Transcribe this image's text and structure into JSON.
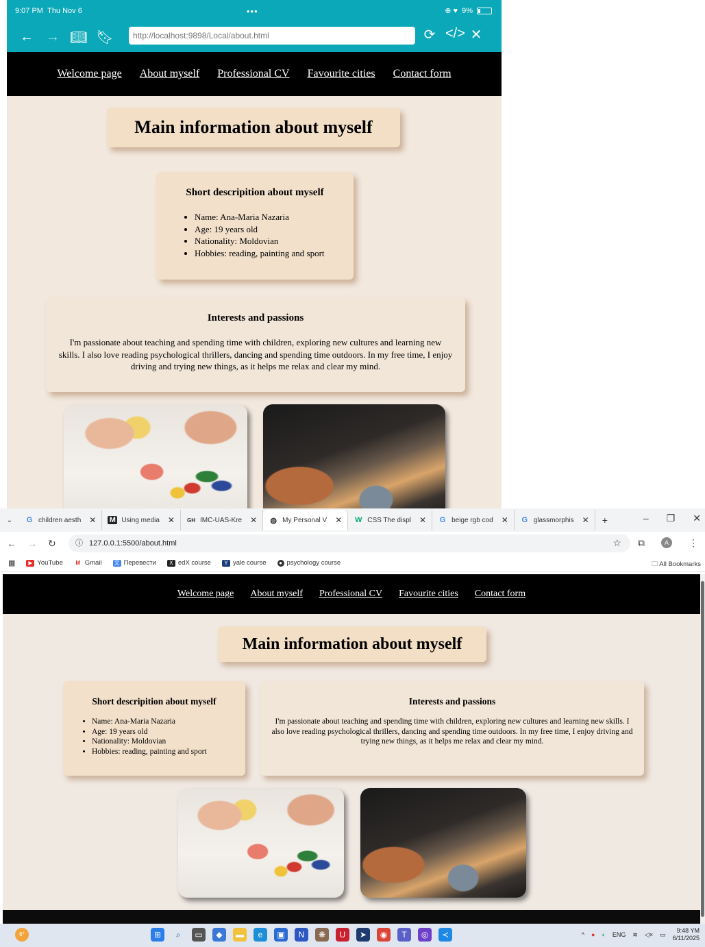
{
  "site": {
    "nav": [
      "Welcome page",
      "About myself",
      "Professional CV",
      "Favourite cities",
      "Contact form"
    ],
    "title": "Main information about myself",
    "short": {
      "heading": "Short descripition about myself",
      "items": [
        "Name: Ana-Maria Nazaria",
        "Age: 19 years old",
        "Nationality: Moldovian",
        "Hobbies: reading, painting and sport"
      ]
    },
    "interests": {
      "heading": "Interests and passions",
      "text": "I'm passionate about teaching and spending time with children, exploring new cultures and learning new skills. I also love reading psychological thrillers, dancing and spending time outdoors. In my free time, I enjoy driving and trying new things, as it helps me relax and clear my mind."
    }
  },
  "ipad": {
    "time": "9:07 PM",
    "date": "Thu Nov 6",
    "battery": "9%",
    "url": "http://localhost:9898/Local/about.html"
  },
  "chrome": {
    "tabs": [
      {
        "icon": "G",
        "label": "children aesth",
        "active": false
      },
      {
        "icon": "M",
        "label": "Using media",
        "active": false
      },
      {
        "icon": "GH",
        "label": "IMC-UAS-Kre",
        "active": false
      },
      {
        "icon": "globe",
        "label": "My Personal V",
        "active": true
      },
      {
        "icon": "W",
        "label": "CSS The displ",
        "active": false
      },
      {
        "icon": "G",
        "label": "beige rgb cod",
        "active": false
      },
      {
        "icon": "G",
        "label": "glassmorphis",
        "active": false
      }
    ],
    "url": "127.0.0.1:5500/about.html",
    "bookmarks": [
      "YouTube",
      "Gmail",
      "Перевести",
      "edX course",
      "yale course",
      "psychology course"
    ],
    "all_bookmarks": "All Bookmarks"
  },
  "taskbar": {
    "weather": "6°",
    "lang": "ENG",
    "time": "9:48 YM",
    "date": "6/11/2025"
  },
  "colors": {
    "ipad_chrome": "#0aa8b8",
    "page_bg": "#f2e8de",
    "card": "#f3dfc6",
    "nav_bg": "#000000"
  }
}
